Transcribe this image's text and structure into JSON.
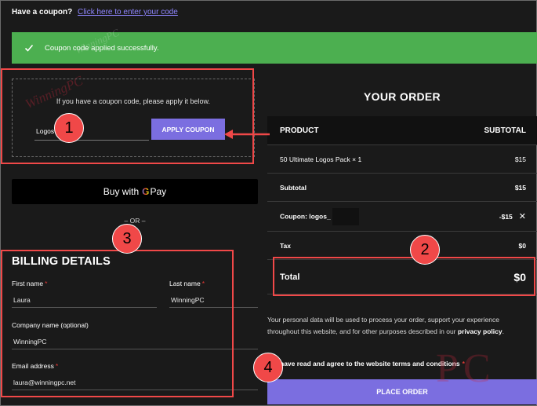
{
  "coupon_bar": {
    "question": "Have a coupon?",
    "link": "Click here to enter your code"
  },
  "notice": {
    "message": "Coupon code applied successfully.",
    "icon": "checkmark-icon"
  },
  "coupon_form": {
    "info": "If you have a coupon code, please apply it below.",
    "input_value": "Logos",
    "apply_label": "APPLY COUPON"
  },
  "gpay": {
    "buy_with": "Buy with",
    "g": "G",
    "pay": "Pay"
  },
  "or_text": "– OR –",
  "billing": {
    "title": "BILLING DETAILS",
    "first_name": {
      "label": "First name",
      "value": "Laura"
    },
    "last_name": {
      "label": "Last name",
      "value": "WinningPC"
    },
    "company": {
      "label": "Company name (optional)",
      "value": "WinningPC"
    },
    "email": {
      "label": "Email address",
      "value": "laura@winningpc.net"
    },
    "required_mark": "*"
  },
  "order": {
    "title": "YOUR ORDER",
    "header": {
      "product": "PRODUCT",
      "subtotal": "SUBTOTAL"
    },
    "item": {
      "name": "50 Ultimate Logos Pack",
      "qty": "× 1",
      "price": "$15"
    },
    "subtotal": {
      "label": "Subtotal",
      "value": "$15"
    },
    "coupon": {
      "label": "Coupon: logos_",
      "value": "-$15",
      "remove": "✕"
    },
    "tax": {
      "label": "Tax",
      "value": "$0"
    },
    "total": {
      "label": "Total",
      "value": "$0"
    }
  },
  "privacy": {
    "text": "Your personal data will be used to process your order, support your experience throughout this website, and for other purposes described in our ",
    "link": "privacy policy",
    "end": "."
  },
  "terms": {
    "text": "have read and agree to the website terms and conditions",
    "required": "*"
  },
  "place_order": "PLACE ORDER",
  "annotations": {
    "one": "1",
    "two": "2",
    "three": "3",
    "four": "4"
  },
  "watermark": {
    "text": "WinningPC",
    "letters": "PC"
  },
  "colors": {
    "accent": "#7b6ee0",
    "success": "#4caf50",
    "annotation": "#f04848",
    "background": "#1a1a1a"
  }
}
